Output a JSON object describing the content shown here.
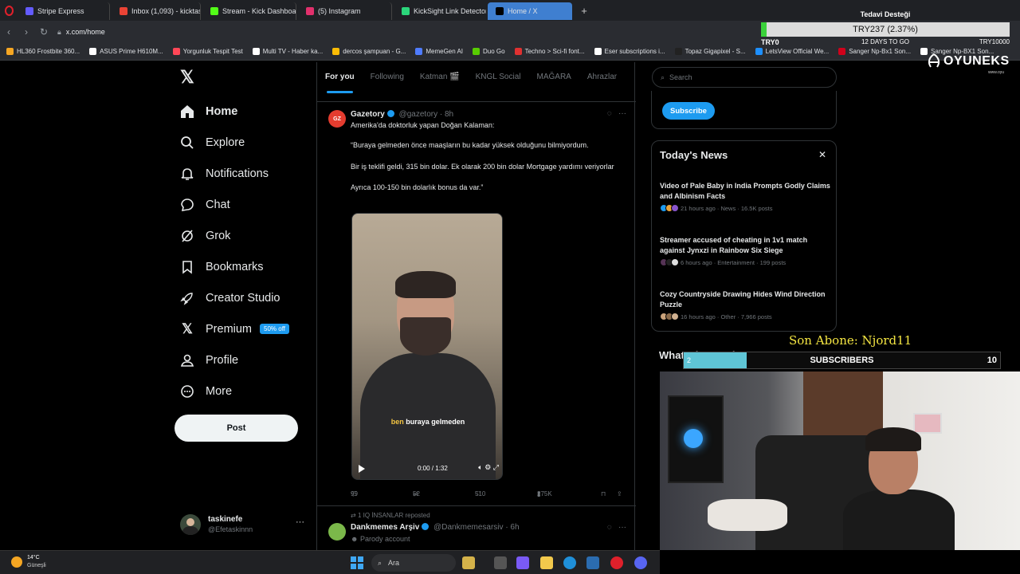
{
  "browser": {
    "tabs": [
      {
        "label": "Stripe Express",
        "color": "#635bff"
      },
      {
        "label": "Inbox (1,093) - kicktaskinef",
        "color": "#ea4335"
      },
      {
        "label": "Stream - Kick Dashboard",
        "color": "#53fc18"
      },
      {
        "label": "(5) Instagram",
        "color": "#e1306c"
      },
      {
        "label": "KickSight Link Detector",
        "color": "#2bd67b"
      },
      {
        "label": "Home / X",
        "color": "#000000"
      }
    ],
    "url": "x.com/home",
    "bookmarks": [
      {
        "label": "HL360 Frostbite 360...",
        "color": "#f5a623"
      },
      {
        "label": "ASUS Prime H610M...",
        "color": "#ffffff"
      },
      {
        "label": "Yorgunluk Tespit Test",
        "color": "#ff4757"
      },
      {
        "label": "Multi TV - Haber ka...",
        "color": "#ffffff"
      },
      {
        "label": "dercos şampuan - G...",
        "color": "#fbbc05"
      },
      {
        "label": "MemeGen AI",
        "color": "#4f7cff"
      },
      {
        "label": "Duo Go",
        "color": "#58cc02"
      },
      {
        "label": "Techno > Sci-fi font...",
        "color": "#e03131"
      },
      {
        "label": "Eser subscriptions i...",
        "color": "#ffffff"
      },
      {
        "label": "Topaz Gigapixel - S...",
        "color": "#222222"
      },
      {
        "label": "LetsView Official We...",
        "color": "#1e90ff"
      },
      {
        "label": "Sanger Np-Bx1 Son...",
        "color": "#d0021b"
      },
      {
        "label": "Sanger Np-BX1 Son...",
        "color": "#ffffff"
      }
    ]
  },
  "donation": {
    "title": "Tedavi Desteği",
    "amount": "TRY237 (2.37%)",
    "progress_fraction": 0.0237,
    "min": "TRY0",
    "days": "12 DAYS TO GO",
    "max": "TRY10000"
  },
  "sponsor": {
    "brand": "OYUNEKS",
    "site": "www.oyu"
  },
  "sidebar": {
    "items": [
      {
        "label": "Home",
        "icon": "home-icon"
      },
      {
        "label": "Explore",
        "icon": "search-icon"
      },
      {
        "label": "Notifications",
        "icon": "bell-icon"
      },
      {
        "label": "Chat",
        "icon": "chat-icon"
      },
      {
        "label": "Grok",
        "icon": "grok-icon"
      },
      {
        "label": "Bookmarks",
        "icon": "bookmark-icon"
      },
      {
        "label": "Creator Studio",
        "icon": "rocket-icon"
      },
      {
        "label": "Premium",
        "icon": "x-logo-icon"
      },
      {
        "label": "Profile",
        "icon": "person-icon"
      },
      {
        "label": "More",
        "icon": "more-circle-icon"
      }
    ],
    "premium_badge": "50% off",
    "post_label": "Post",
    "account": {
      "name": "taskinefe",
      "handle": "@Efetaskinnn"
    }
  },
  "feed": {
    "tabs": [
      "For you",
      "Following",
      "Katman 🎬",
      "KNGL Social",
      "MAĞARA",
      "Ahrazlar"
    ],
    "tweet": {
      "avatar_text": "GZ",
      "name": "Gazetory",
      "handle": "@gazetory",
      "time": "· 8h",
      "lines": [
        "Amerika'da doktorluk yapan Doğan Kalaman:",
        "“Buraya gelmeden önce maaşların bu kadar yüksek olduğunu bilmiyordum.",
        "Bir iş teklifi geldi, 315 bin dolar.  Ek olarak 200 bin dolar Mortgage yardımı veriyorlar",
        "Ayrıca 100-150 bin dolarlık bonus da var.”"
      ],
      "video_caption_highlight": "ben",
      "video_caption_rest": " buraya gelmeden",
      "video_time": "0:00 / 1:32",
      "replies": "99",
      "reposts": "52",
      "likes": "510",
      "views": "275K"
    },
    "tweet2": {
      "repost_line": "1 IQ İNSANLAR reposted",
      "name": "Dankmemes Arşiv",
      "handle": "@Dankmemesarsiv",
      "time": "· 6h",
      "sub": "Parody account"
    }
  },
  "right": {
    "search_placeholder": "Search",
    "subscribe_label": "Subscribe",
    "news_title": "Today's News",
    "news": [
      {
        "title": "Video of Pale Baby in India Prompts Godly Claims and Albinism Facts",
        "meta": "21 hours ago · News · 16.5K posts",
        "avatar_colors": [
          "#1d9bf0",
          "#e8a33b",
          "#8855cc"
        ]
      },
      {
        "title": "Streamer accused of cheating in 1v1 match against Jynxzi in Rainbow Six Siege",
        "meta": "6 hours ago · Entertainment · 199 posts",
        "avatar_colors": [
          "#553355",
          "#222222",
          "#dddddd"
        ]
      },
      {
        "title": "Cozy Countryside Drawing Hides Wind Direction Puzzle",
        "meta": "16 hours ago · Other · 7,966 posts",
        "avatar_colors": [
          "#c9a27a",
          "#8a6a4a",
          "#d0b090"
        ]
      }
    ],
    "happening_title": "What's happening"
  },
  "overlay": {
    "last_sub": "Son Abone: Njord11",
    "sub_current": "2",
    "sub_label": "SUBSCRIBERS",
    "sub_goal": "10",
    "sub_fraction": 0.2
  },
  "taskbar": {
    "temperature": "14°C",
    "condition": "Güneşli",
    "search_label": "Ara"
  }
}
